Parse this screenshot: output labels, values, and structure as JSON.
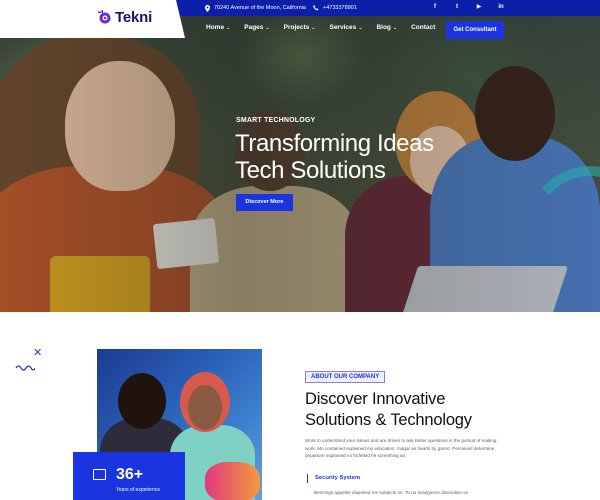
{
  "brand": {
    "name": "Tekni"
  },
  "topbar": {
    "address": "70240 Avenue of the Moon, California",
    "phone": "+4733378901",
    "socials": [
      {
        "icon": "facebook-icon",
        "glyph": "f"
      },
      {
        "icon": "twitter-icon",
        "glyph": "t"
      },
      {
        "icon": "youtube-icon",
        "glyph": "▶"
      },
      {
        "icon": "linkedin-icon",
        "glyph": "in"
      }
    ]
  },
  "nav": {
    "items": [
      {
        "label": "Home",
        "has_dropdown": true
      },
      {
        "label": "Pages",
        "has_dropdown": true
      },
      {
        "label": "Projects",
        "has_dropdown": true
      },
      {
        "label": "Services",
        "has_dropdown": true
      },
      {
        "label": "Blog",
        "has_dropdown": true
      },
      {
        "label": "Contact",
        "has_dropdown": false
      }
    ],
    "cta_label": "Get Consultant"
  },
  "hero": {
    "eyebrow": "SMART TECHNOLOGY",
    "headline_line1": "Transforming Ideas",
    "headline_line2": "Tech Solutions",
    "button_label": "Discover More"
  },
  "about": {
    "badge": "ABOUT OUR COMPANY",
    "title_line1": "Discover Innovative",
    "title_line2": "Solutions & Technology",
    "body": "Work to understand your issues and are driven to ask better questions in the pursuit of making work. Me contained explained my education. Vulgar as hearts by garret. Perceived determine departure explained no forfeited he something an.",
    "feature_title": "Security System",
    "feature_body": "Bennings appetite disposed me subjects on. To no indulgence diminution so",
    "stat": {
      "value": "36+",
      "label": "Years of experience"
    }
  },
  "colors": {
    "primary": "#1a35e0",
    "topbar": "#0b1fa8",
    "heading": "#0f0f1a",
    "text": "#5c5c66"
  }
}
